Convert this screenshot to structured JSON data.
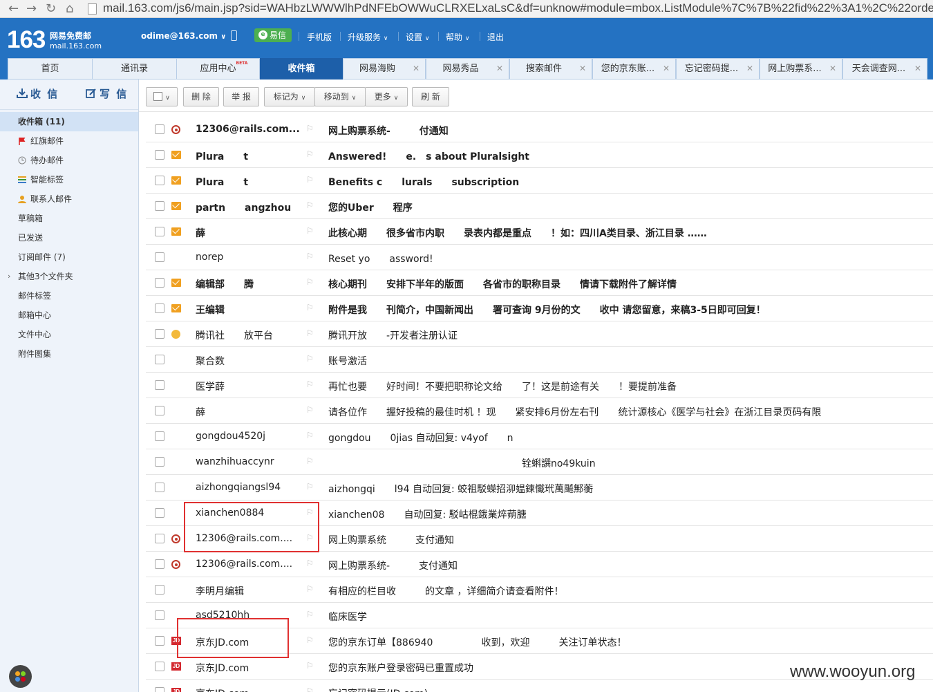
{
  "browser": {
    "url": "mail.163.com/js6/main.jsp?sid=WAHbzLWWWlhPdNFEbOWWuCLRXELxaLsC&df=unknow#module=mbox.ListModule%7C%7B%22fid%22%3A1%2C%22orde"
  },
  "header": {
    "logo_number": "163",
    "logo_name": "网易免费邮",
    "logo_domain": "mail.163.com",
    "account": "odime@163.com",
    "yixin": "易信",
    "links": [
      "手机版",
      "升级服务",
      "设置",
      "帮助",
      "退出"
    ]
  },
  "tabs": [
    {
      "label": "首页"
    },
    {
      "label": "通讯录"
    },
    {
      "label": "应用中心",
      "badge": "BETA"
    },
    {
      "label": "收件箱"
    },
    {
      "label": "网易海购"
    },
    {
      "label": "网易秀品"
    },
    {
      "label": "搜索邮件"
    },
    {
      "label": "您的京东账..."
    },
    {
      "label": "忘记密码提..."
    },
    {
      "label": "网上购票系..."
    },
    {
      "label": "天会调查网..."
    }
  ],
  "sidebar": {
    "receive": "收 信",
    "compose": "写 信",
    "folders": [
      {
        "label": "收件箱 (11)"
      },
      {
        "label": "红旗邮件"
      },
      {
        "label": "待办邮件"
      },
      {
        "label": "智能标签"
      },
      {
        "label": "联系人邮件"
      },
      {
        "label": "草稿箱"
      },
      {
        "label": "已发送"
      },
      {
        "label": "订阅邮件 (7)"
      },
      {
        "label": "其他3个文件夹"
      },
      {
        "label": "邮件标签"
      },
      {
        "label": "邮箱中心"
      },
      {
        "label": "文件中心"
      },
      {
        "label": "附件图集"
      }
    ]
  },
  "toolbar": {
    "delete": "删 除",
    "report": "举 报",
    "mark_as": "标记为",
    "move_to": "移动到",
    "more": "更多",
    "refresh": "刷 新"
  },
  "mails": [
    {
      "sender": "12306@rails.com...",
      "subject": "网上购票系统-　　　付通知",
      "icon": "circle",
      "unread": true
    },
    {
      "sender": "Plura　　t",
      "subject": "Answered!　　e.　s about Pluralsight",
      "icon": "envelope",
      "unread": true
    },
    {
      "sender": "Plura　　t",
      "subject": "Benefits c　　lurals　　subscription",
      "icon": "envelope",
      "unread": true
    },
    {
      "sender": "partn　　angzhou",
      "subject": "您的Uber　　程序",
      "icon": "envelope",
      "unread": true
    },
    {
      "sender": "薛",
      "subject": "此核心期　　很多省市内职　　录表内都是重点　　！如：四川A类目录、浙江目录 ……",
      "icon": "envelope",
      "unread": true
    },
    {
      "sender": "norep",
      "subject": "Reset yo　　assword!",
      "icon": "",
      "unread": false
    },
    {
      "sender": "编辑部　　腾",
      "subject": "核心期刊　　安排下半年的版面　　各省市的职称目录　　情请下载附件了解详情",
      "icon": "envelope",
      "unread": true
    },
    {
      "sender": "王编辑",
      "subject": "附件是我　　刊简介，中国新闻出　　署可查询 9月份的文　　收中 请您留意，来稿3-5日即可回复！",
      "icon": "envelope",
      "unread": true
    },
    {
      "sender": "腾讯社　　放平台",
      "subject": "腾讯开放　　-开发者注册认证",
      "icon": "key",
      "unread": false
    },
    {
      "sender": "聚合数",
      "subject": "账号激活",
      "icon": "",
      "unread": false
    },
    {
      "sender": "医学薛",
      "subject": "再忙也要　　好时间！不要把职称论文给　　了！这是前途有关　　！要提前准备",
      "icon": "",
      "unread": false
    },
    {
      "sender": "薛",
      "subject": "请各位作　　握好投稿的最佳时机 ！现　　紧安排6月份左右刊　　统计源核心《医学与社会》在浙江目录页码有限",
      "icon": "",
      "unread": false
    },
    {
      "sender": "gongdou4520j",
      "subject": "gongdou　　0jias 自动回复: v4yof　　n",
      "icon": "",
      "unread": false
    },
    {
      "sender": "wanzhihuaccynr",
      "subject": "　　　　　　　　　　　　　　　　　　　　铨蝌譔no49kuin",
      "icon": "",
      "unread": false
    },
    {
      "sender": "aizhongqiangsl94",
      "subject": "aizhongqi　　l94 自动回复: 蛟祖駁蠑招泖媪鍊懺玳萬飇鄦蘅　　",
      "icon": "",
      "unread": false
    },
    {
      "sender": "xianchen0884",
      "subject": "xianchen08　　自动回复: 駁岵棍鋨業焠蒴膅",
      "icon": "",
      "unread": false
    },
    {
      "sender": "12306@rails.com....",
      "subject": "网上购票系统　　　支付通知",
      "icon": "circle",
      "unread": false
    },
    {
      "sender": "12306@rails.com....",
      "subject": "网上购票系统-　　　支付通知",
      "icon": "circle",
      "unread": false
    },
    {
      "sender": "李明月编辑",
      "subject": "有相应的栏目收　　　的文章 ，详细简介请查看附件！",
      "icon": "",
      "unread": false
    },
    {
      "sender": "asd5210hh",
      "subject": "临床医学",
      "icon": "",
      "unread": false
    },
    {
      "sender": "京东JD.com",
      "subject": "您的京东订单【886940　　　　　收到，欢迎　　　关注订单状态！",
      "icon": "jd",
      "unread": false
    },
    {
      "sender": "京东JD.com",
      "subject": "您的京东账户登录密码已重置成功",
      "icon": "jd",
      "unread": false
    },
    {
      "sender": "京东JD.com",
      "subject": "忘记密码提示(JD.com)",
      "icon": "jd",
      "unread": false
    }
  ],
  "watermark": "www.wooyun.org",
  "colors": {
    "header_blue": "#2472c2",
    "active_tab": "#1d5fa9",
    "highlight_red": "#e03030",
    "unread_icon": "#f0a020"
  }
}
